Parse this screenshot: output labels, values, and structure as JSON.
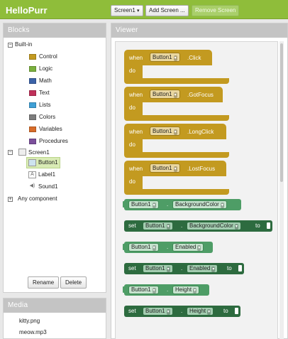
{
  "app": {
    "title": "HelloPurr"
  },
  "toolbar": {
    "screen": "Screen1",
    "add_screen": "Add Screen ...",
    "remove_screen": "Remove Screen"
  },
  "blocks_panel": {
    "header": "Blocks",
    "builtin_label": "Built-in",
    "builtin": [
      {
        "label": "Control",
        "color": "#c39a20"
      },
      {
        "label": "Logic",
        "color": "#7ab03d"
      },
      {
        "label": "Math",
        "color": "#3b62a8"
      },
      {
        "label": "Text",
        "color": "#c0305a"
      },
      {
        "label": "Lists",
        "color": "#3fa0d6"
      },
      {
        "label": "Colors",
        "color": "#7d7d7d"
      },
      {
        "label": "Variables",
        "color": "#d86c2a"
      },
      {
        "label": "Procedures",
        "color": "#7b4f9b"
      }
    ],
    "screen_label": "Screen1",
    "components": [
      {
        "label": "Button1"
      },
      {
        "label": "Label1"
      },
      {
        "label": "Sound1"
      }
    ],
    "any_component": "Any component",
    "rename": "Rename",
    "delete": "Delete"
  },
  "media_panel": {
    "header": "Media",
    "items": [
      "kitty.png",
      "meow.mp3"
    ]
  },
  "viewer": {
    "header": "Viewer",
    "events": [
      {
        "when": "when",
        "component": "Button1",
        "event": ".Click",
        "do": "do"
      },
      {
        "when": "when",
        "component": "Button1",
        "event": ".GotFocus",
        "do": "do"
      },
      {
        "when": "when",
        "component": "Button1",
        "event": ".LongClick",
        "do": "do"
      },
      {
        "when": "when",
        "component": "Button1",
        "event": ".LostFocus",
        "do": "do"
      }
    ],
    "props": [
      {
        "kind": "get",
        "component": "Button1",
        "property": "BackgroundColor"
      },
      {
        "kind": "set",
        "set": "set",
        "component": "Button1",
        "property": "BackgroundColor",
        "to": "to"
      },
      {
        "kind": "get",
        "component": "Button1",
        "property": "Enabled"
      },
      {
        "kind": "set",
        "set": "set",
        "component": "Button1",
        "property": "Enabled",
        "to": "to"
      },
      {
        "kind": "get",
        "component": "Button1",
        "property": "Height"
      },
      {
        "kind": "set",
        "set": "set",
        "component": "Button1",
        "property": "Height",
        "to": "to"
      }
    ],
    "dot": ".",
    "dropdown_arrow": "▾"
  }
}
